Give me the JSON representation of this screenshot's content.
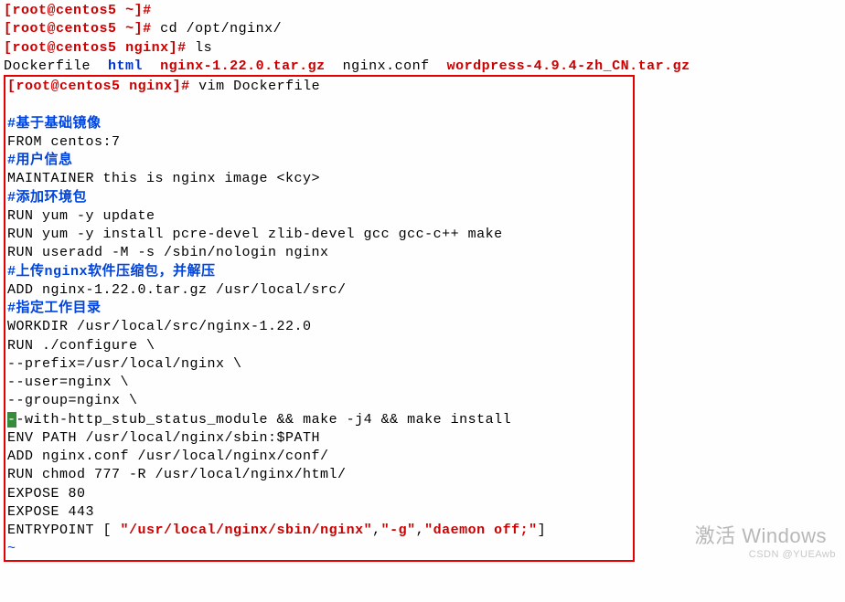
{
  "prompt1": {
    "uh": "root@centos5",
    "dir": "~",
    "cmd": ""
  },
  "prompt2": {
    "uh": "root@centos5",
    "dir": "~",
    "cmd": "cd /opt/nginx/"
  },
  "prompt3": {
    "uh": "root@centos5",
    "dir": "nginx",
    "cmd": "ls"
  },
  "ls": {
    "i1": "Dockerfile",
    "i2": "html",
    "i3": "nginx-1.22.0.tar.gz",
    "i4": "nginx.conf",
    "i5": "wordpress-4.9.4-zh_CN.tar.gz"
  },
  "prompt4": {
    "uh": "root@centos5",
    "dir": "nginx",
    "cmd": "vim Dockerfile"
  },
  "vim": {
    "c1": "基于基础镜像",
    "l1": "FROM centos:7",
    "c2": "用户信息",
    "l2": "MAINTAINER this is nginx image <kcy>",
    "c3": "添加环境包",
    "l3": "RUN yum -y update",
    "l4": "RUN yum -y install pcre-devel zlib-devel gcc gcc-c++ make",
    "l5": "RUN useradd -M -s /sbin/nologin nginx",
    "c4a": "上传",
    "c4b": "nginx",
    "c4c": "软件压缩包，并解压",
    "l6": "ADD nginx-1.22.0.tar.gz /usr/local/src/",
    "c5": "指定工作目录",
    "l7": "WORKDIR /usr/local/src/nginx-1.22.0",
    "l8": "RUN ./configure \\",
    "l9": "--prefix=/usr/local/nginx \\",
    "l10": "--user=nginx \\",
    "l11": "--group=nginx \\",
    "l12a": "-",
    "l12b": "-with-http_stub_status_module && make -j4 && make install",
    "l13": "ENV PATH /usr/local/nginx/sbin:$PATH",
    "l14": "ADD nginx.conf /usr/local/nginx/conf/",
    "l15": "RUN chmod 777 -R /usr/local/nginx/html/",
    "l16": "EXPOSE 80",
    "l17": "EXPOSE 443",
    "l18a": "ENTRYPOINT [ ",
    "s1": "\"/usr/local/nginx/sbin/nginx\"",
    "l18b": ",",
    "s2": "\"-g\"",
    "l18c": ",",
    "s3": "\"daemon off;\"",
    "l18d": "]",
    "tilde": "~"
  },
  "wm1": "激活 Windows",
  "wm2": "CSDN @YUEAwb"
}
